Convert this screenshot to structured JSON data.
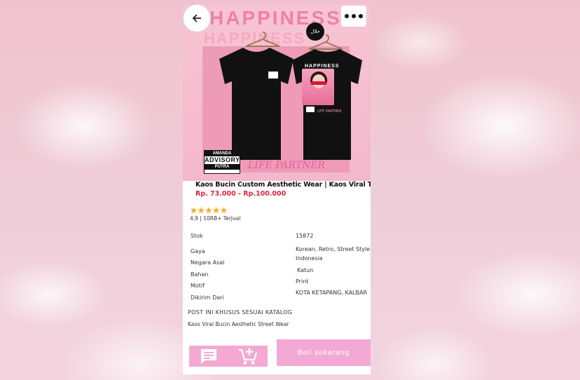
{
  "hero": {
    "brand_text": "HAPPINESS",
    "brand_stack_text": "HAPPINESS",
    "print_title": "HAPPINESS",
    "halal_badge": "حلال",
    "advisory_top": "AMANDA",
    "advisory_mid": "ADVISORY",
    "advisory_bottom": "PUTRA",
    "tagline": "LIFE PARTNER",
    "print_tagline": "LIFE PARTNER"
  },
  "nav": {
    "back_icon": "arrow-left-icon",
    "more_icon": "more-dots-icon"
  },
  "product": {
    "title": "Kaos Bucin Custom Aesthetic Wear | Kaos Viral Tiktok",
    "price": "Rp. 73.000 - Rp.100.000",
    "rating_stars": 5,
    "rating_text": "4,9 | 10RB+ Terjual"
  },
  "specs": {
    "labels": [
      "Stok",
      "Gaya",
      "Negara Asal",
      "Bahan",
      "Motif",
      "Dikirim Dari"
    ],
    "stock_value": "15872",
    "gaya_value_line1": "Korean, Retro, Street Style",
    "negara_value": "Indonesia",
    "bahan_value": "Katun",
    "motif_value": "Print",
    "dikirim_value": "KOTA KETAPANG, KALBAR"
  },
  "catalog": {
    "title": "POST INI KHUSUS SESUAI KATALOG",
    "desc": "Kaos Viral Bucin Aesthetic Street Wear"
  },
  "actions": {
    "chat_icon": "chat-icon",
    "cart_icon": "add-cart-icon",
    "buy_label": "Beli sekarang"
  },
  "colors": {
    "accent_pink": "#f3a9d3",
    "price_red": "#e0253f",
    "star": "#f3b324"
  }
}
